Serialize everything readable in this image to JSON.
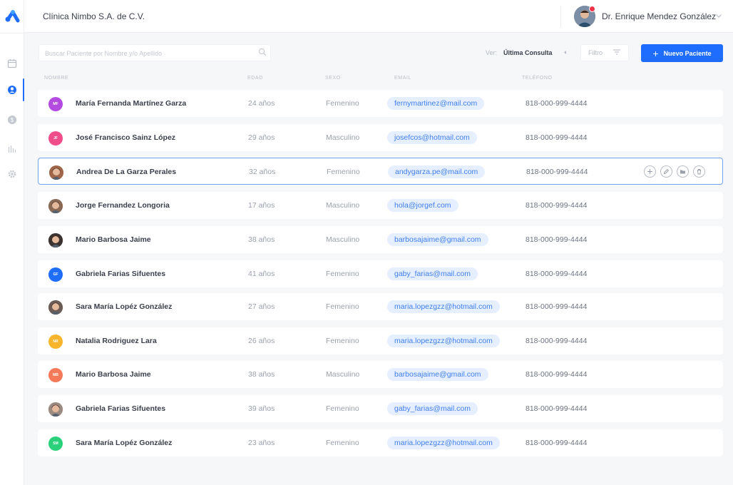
{
  "app": {
    "clinic_name": "Clínica Nimbo S.A. de C.V.",
    "user_name": "Dr. Enrique Mendez González"
  },
  "colors": {
    "accent": "#1e6dff",
    "email_chip_bg": "#e6efff",
    "email_chip_text": "#3f7ff2",
    "notification_dot": "#f2334a"
  },
  "sidebar": {
    "items": [
      {
        "icon": "calendar-icon",
        "active": false
      },
      {
        "icon": "patients-icon",
        "active": true
      },
      {
        "icon": "billing-icon",
        "active": false
      },
      {
        "icon": "stats-icon",
        "active": false
      },
      {
        "icon": "gear-icon",
        "active": false
      }
    ]
  },
  "toolbar": {
    "search_placeholder": "Buscar Paciente por Nombre y/o Apellido",
    "ver_label": "Ver:",
    "ver_value": "Última Consulta",
    "filter_label": "Filtro",
    "new_patient_label": "Nuevo Paciente"
  },
  "columns": {
    "name": "NOMBRE",
    "age": "EDAD",
    "sex": "SEXO",
    "email": "EMAIL",
    "phone": "TELÉFONO"
  },
  "patients": [
    {
      "name": "María Fernanda Martínez Garza",
      "age": "24 años",
      "sex": "Femenino",
      "email": "fernymartinez@mail.com",
      "phone": "818-000-999-4444",
      "initials": "MF",
      "avatar_color": "#b44be0",
      "photo": false
    },
    {
      "name": "José Francisco Sainz López",
      "age": "29 años",
      "sex": "Masculino",
      "email": "josefcos@hotmail.com",
      "phone": "818-000-999-4444",
      "initials": "JF",
      "avatar_color": "#f04e8a",
      "photo": false
    },
    {
      "name": "Andrea De La Garza Perales",
      "age": "32 años",
      "sex": "Femenino",
      "email": "andygarza.pe@mail.com",
      "phone": "818-000-999-4444",
      "initials": "",
      "avatar_color": "#a0664a",
      "photo": true
    },
    {
      "name": "Jorge Fernandez Longoria",
      "age": "17 años",
      "sex": "Masculino",
      "email": "hola@jorgef.com",
      "phone": "818-000-999-4444",
      "initials": "",
      "avatar_color": "#8a6a55",
      "photo": true
    },
    {
      "name": "Mario Barbosa Jaime",
      "age": "38 años",
      "sex": "Masculino",
      "email": "barbosajaime@gmail.com",
      "phone": "818-000-999-4444",
      "initials": "",
      "avatar_color": "#3b3330",
      "photo": true
    },
    {
      "name": "Gabriela Farias Sifuentes",
      "age": "41 años",
      "sex": "Femenino",
      "email": "gaby_farias@mail.com",
      "phone": "818-000-999-4444",
      "initials": "GF",
      "avatar_color": "#1e6dff",
      "photo": false
    },
    {
      "name": "Sara María Lopéz González",
      "age": "27 años",
      "sex": "Femenino",
      "email": "maria.lopezgzz@hotmail.com",
      "phone": "818-000-999-4444",
      "initials": "",
      "avatar_color": "#6b5d55",
      "photo": true
    },
    {
      "name": "Natalia Rodriguez Lara",
      "age": "26 años",
      "sex": "Femenino",
      "email": "maria.lopezgzz@hotmail.com",
      "phone": "818-000-999-4444",
      "initials": "NR",
      "avatar_color": "#f7b52c",
      "photo": false
    },
    {
      "name": "Mario Barbosa Jaime",
      "age": "38 años",
      "sex": "Masculino",
      "email": "barbosajaime@gmail.com",
      "phone": "818-000-999-4444",
      "initials": "MB",
      "avatar_color": "#f47a5a",
      "photo": false
    },
    {
      "name": "Gabriela Farias Sifuentes",
      "age": "39 años",
      "sex": "Femenino",
      "email": "gaby_farias@mail.com",
      "phone": "818-000-999-4444",
      "initials": "",
      "avatar_color": "#9b8a80",
      "photo": true
    },
    {
      "name": "Sara María Lopéz González",
      "age": "23 años",
      "sex": "Femenino",
      "email": "maria.lopezgzz@hotmail.com",
      "phone": "818-000-999-4444",
      "initials": "SM",
      "avatar_color": "#2bd17a",
      "photo": false
    }
  ],
  "selected_row": 2,
  "row_actions": [
    "add-icon",
    "edit-icon",
    "folder-icon",
    "trash-icon"
  ]
}
